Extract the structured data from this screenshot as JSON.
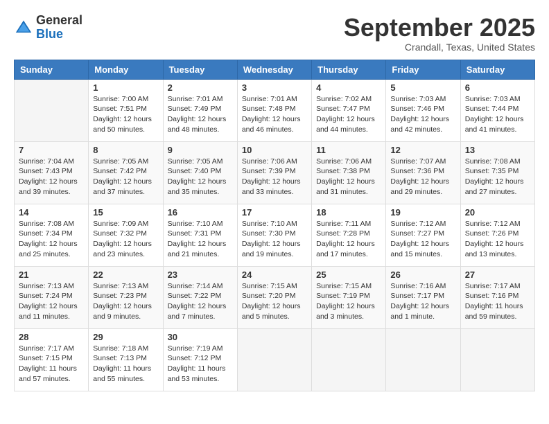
{
  "header": {
    "logo_general": "General",
    "logo_blue": "Blue",
    "month_title": "September 2025",
    "location": "Crandall, Texas, United States"
  },
  "weekdays": [
    "Sunday",
    "Monday",
    "Tuesday",
    "Wednesday",
    "Thursday",
    "Friday",
    "Saturday"
  ],
  "weeks": [
    [
      {
        "day": "",
        "info": ""
      },
      {
        "day": "1",
        "info": "Sunrise: 7:00 AM\nSunset: 7:51 PM\nDaylight: 12 hours\nand 50 minutes."
      },
      {
        "day": "2",
        "info": "Sunrise: 7:01 AM\nSunset: 7:49 PM\nDaylight: 12 hours\nand 48 minutes."
      },
      {
        "day": "3",
        "info": "Sunrise: 7:01 AM\nSunset: 7:48 PM\nDaylight: 12 hours\nand 46 minutes."
      },
      {
        "day": "4",
        "info": "Sunrise: 7:02 AM\nSunset: 7:47 PM\nDaylight: 12 hours\nand 44 minutes."
      },
      {
        "day": "5",
        "info": "Sunrise: 7:03 AM\nSunset: 7:46 PM\nDaylight: 12 hours\nand 42 minutes."
      },
      {
        "day": "6",
        "info": "Sunrise: 7:03 AM\nSunset: 7:44 PM\nDaylight: 12 hours\nand 41 minutes."
      }
    ],
    [
      {
        "day": "7",
        "info": "Sunrise: 7:04 AM\nSunset: 7:43 PM\nDaylight: 12 hours\nand 39 minutes."
      },
      {
        "day": "8",
        "info": "Sunrise: 7:05 AM\nSunset: 7:42 PM\nDaylight: 12 hours\nand 37 minutes."
      },
      {
        "day": "9",
        "info": "Sunrise: 7:05 AM\nSunset: 7:40 PM\nDaylight: 12 hours\nand 35 minutes."
      },
      {
        "day": "10",
        "info": "Sunrise: 7:06 AM\nSunset: 7:39 PM\nDaylight: 12 hours\nand 33 minutes."
      },
      {
        "day": "11",
        "info": "Sunrise: 7:06 AM\nSunset: 7:38 PM\nDaylight: 12 hours\nand 31 minutes."
      },
      {
        "day": "12",
        "info": "Sunrise: 7:07 AM\nSunset: 7:36 PM\nDaylight: 12 hours\nand 29 minutes."
      },
      {
        "day": "13",
        "info": "Sunrise: 7:08 AM\nSunset: 7:35 PM\nDaylight: 12 hours\nand 27 minutes."
      }
    ],
    [
      {
        "day": "14",
        "info": "Sunrise: 7:08 AM\nSunset: 7:34 PM\nDaylight: 12 hours\nand 25 minutes."
      },
      {
        "day": "15",
        "info": "Sunrise: 7:09 AM\nSunset: 7:32 PM\nDaylight: 12 hours\nand 23 minutes."
      },
      {
        "day": "16",
        "info": "Sunrise: 7:10 AM\nSunset: 7:31 PM\nDaylight: 12 hours\nand 21 minutes."
      },
      {
        "day": "17",
        "info": "Sunrise: 7:10 AM\nSunset: 7:30 PM\nDaylight: 12 hours\nand 19 minutes."
      },
      {
        "day": "18",
        "info": "Sunrise: 7:11 AM\nSunset: 7:28 PM\nDaylight: 12 hours\nand 17 minutes."
      },
      {
        "day": "19",
        "info": "Sunrise: 7:12 AM\nSunset: 7:27 PM\nDaylight: 12 hours\nand 15 minutes."
      },
      {
        "day": "20",
        "info": "Sunrise: 7:12 AM\nSunset: 7:26 PM\nDaylight: 12 hours\nand 13 minutes."
      }
    ],
    [
      {
        "day": "21",
        "info": "Sunrise: 7:13 AM\nSunset: 7:24 PM\nDaylight: 12 hours\nand 11 minutes."
      },
      {
        "day": "22",
        "info": "Sunrise: 7:13 AM\nSunset: 7:23 PM\nDaylight: 12 hours\nand 9 minutes."
      },
      {
        "day": "23",
        "info": "Sunrise: 7:14 AM\nSunset: 7:22 PM\nDaylight: 12 hours\nand 7 minutes."
      },
      {
        "day": "24",
        "info": "Sunrise: 7:15 AM\nSunset: 7:20 PM\nDaylight: 12 hours\nand 5 minutes."
      },
      {
        "day": "25",
        "info": "Sunrise: 7:15 AM\nSunset: 7:19 PM\nDaylight: 12 hours\nand 3 minutes."
      },
      {
        "day": "26",
        "info": "Sunrise: 7:16 AM\nSunset: 7:17 PM\nDaylight: 12 hours\nand 1 minute."
      },
      {
        "day": "27",
        "info": "Sunrise: 7:17 AM\nSunset: 7:16 PM\nDaylight: 11 hours\nand 59 minutes."
      }
    ],
    [
      {
        "day": "28",
        "info": "Sunrise: 7:17 AM\nSunset: 7:15 PM\nDaylight: 11 hours\nand 57 minutes."
      },
      {
        "day": "29",
        "info": "Sunrise: 7:18 AM\nSunset: 7:13 PM\nDaylight: 11 hours\nand 55 minutes."
      },
      {
        "day": "30",
        "info": "Sunrise: 7:19 AM\nSunset: 7:12 PM\nDaylight: 11 hours\nand 53 minutes."
      },
      {
        "day": "",
        "info": ""
      },
      {
        "day": "",
        "info": ""
      },
      {
        "day": "",
        "info": ""
      },
      {
        "day": "",
        "info": ""
      }
    ]
  ]
}
